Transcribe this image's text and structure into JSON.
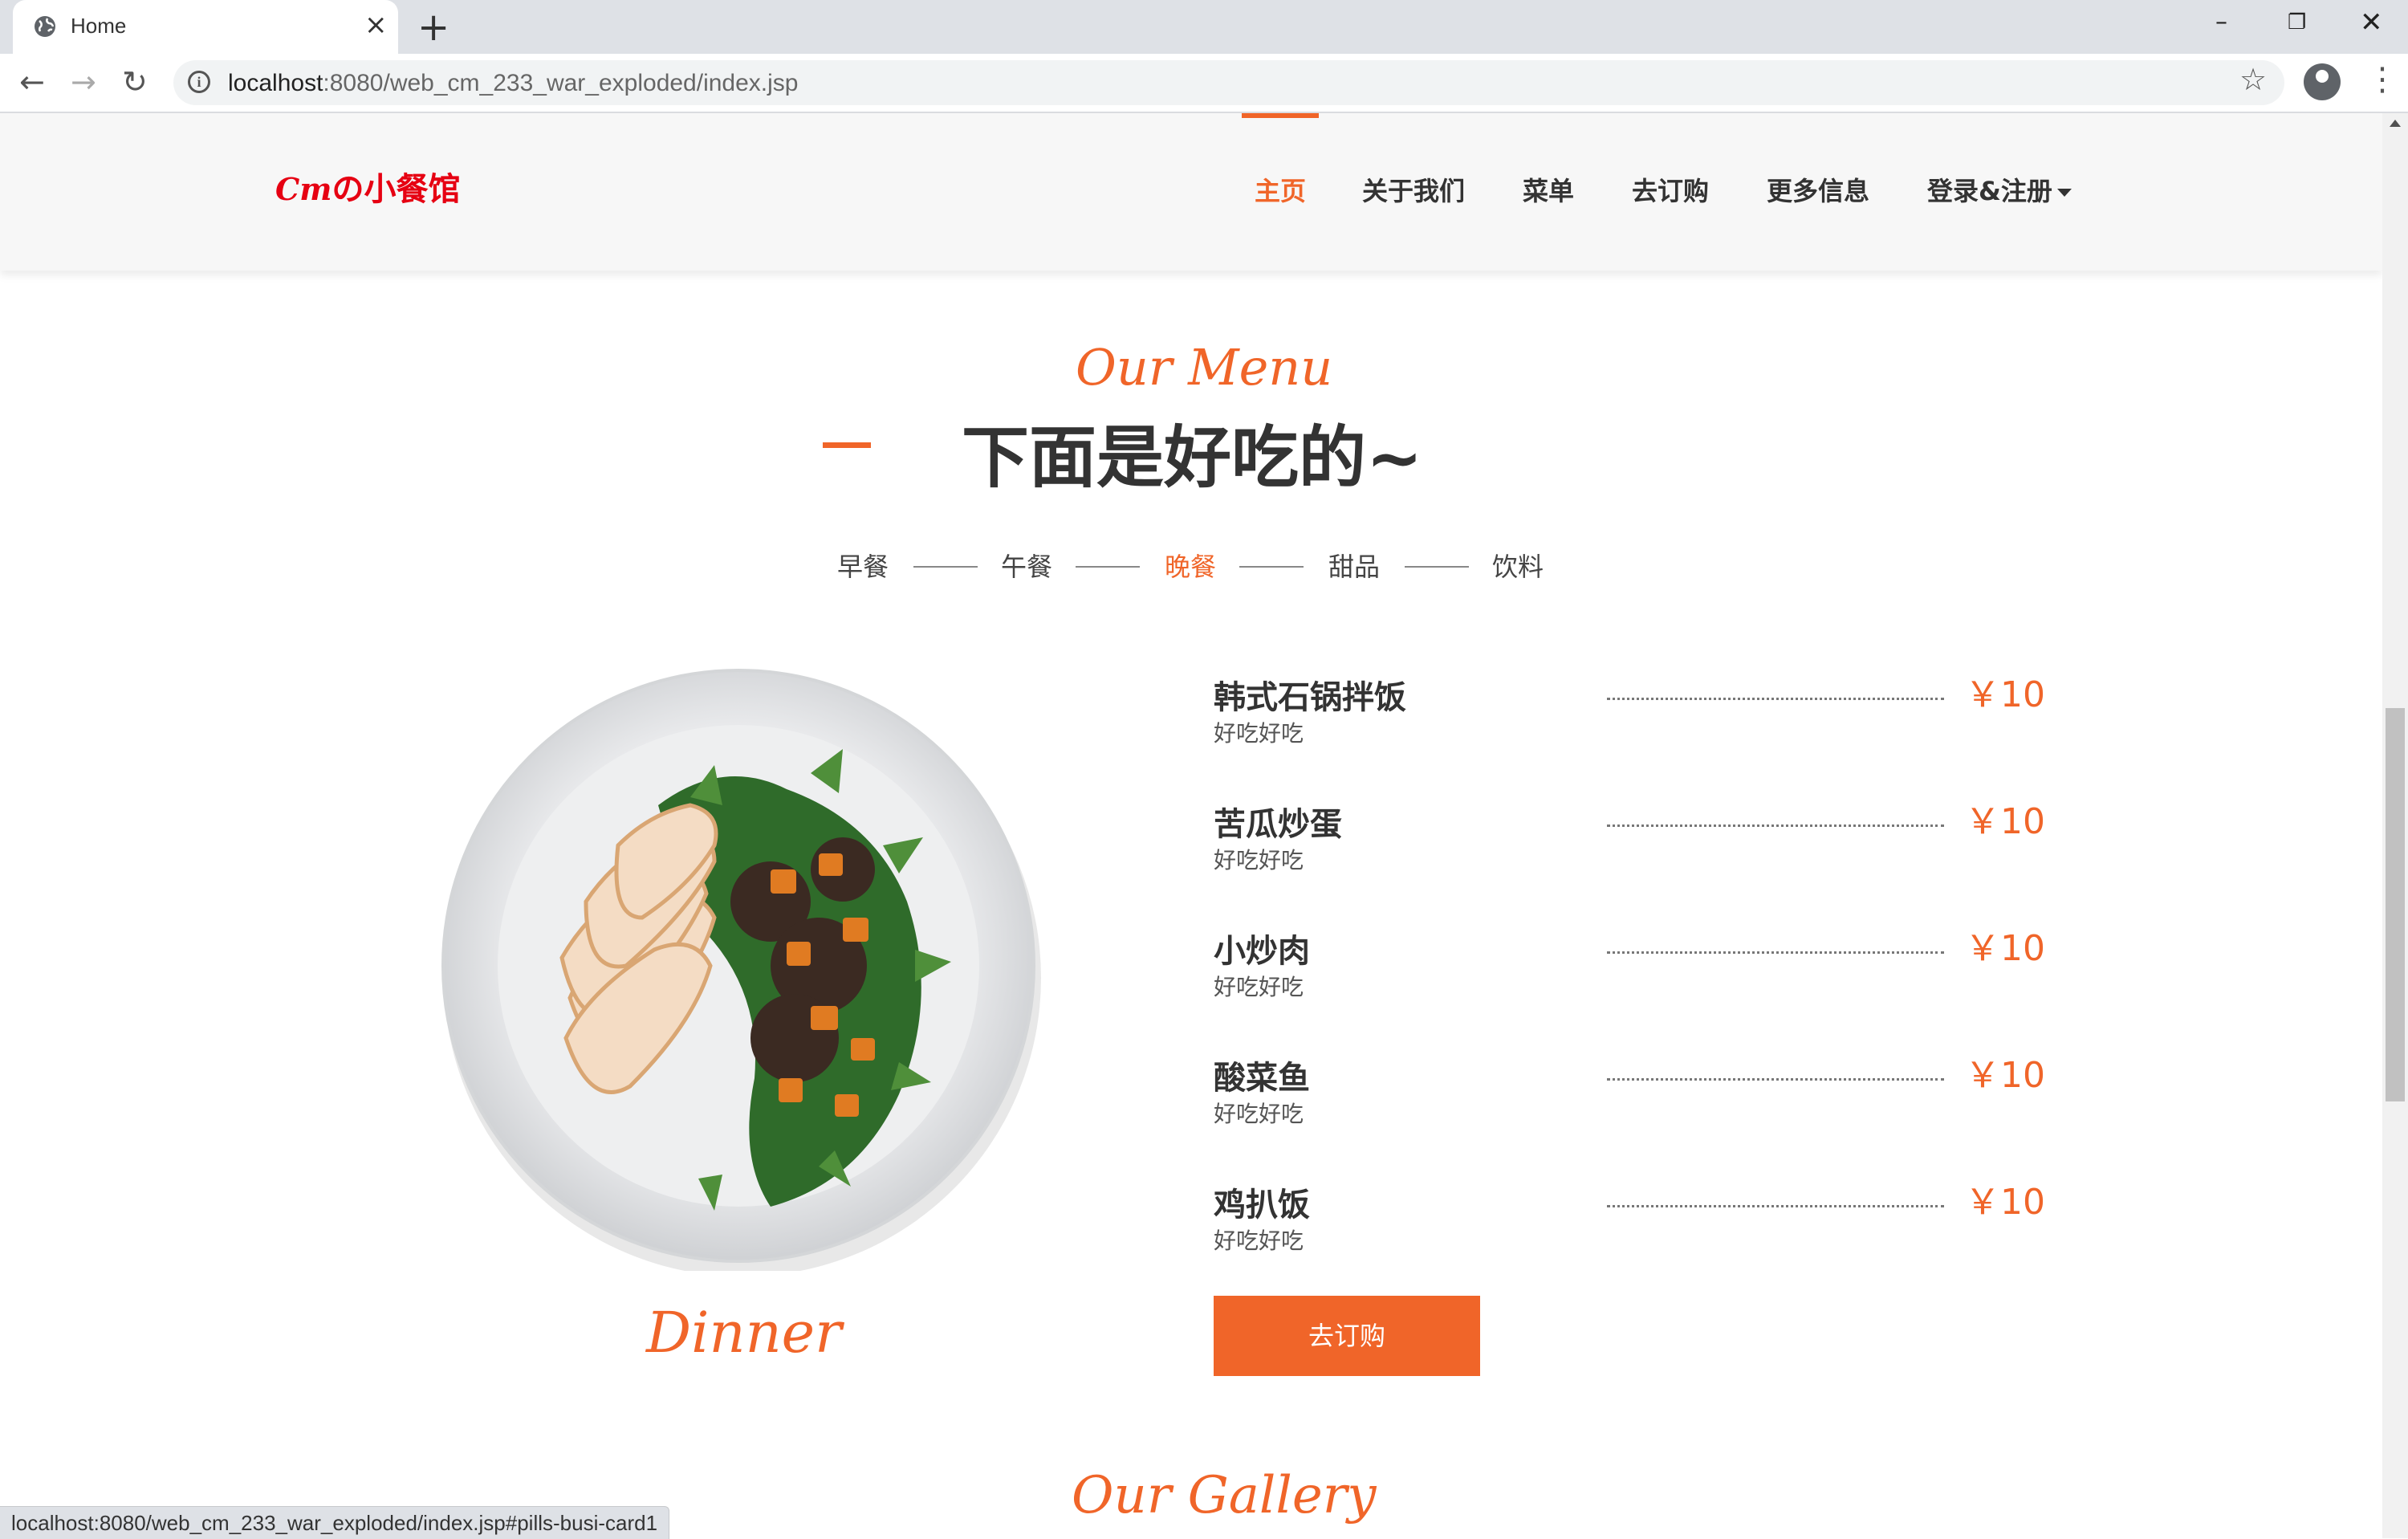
{
  "browser": {
    "tab_title": "Home",
    "url_host": "localhost",
    "url_rest": ":8080/web_cm_233_war_exploded/index.jsp",
    "status_url": "localhost:8080/web_cm_233_war_exploded/index.jsp#pills-busi-card1"
  },
  "site": {
    "logo_script": "Cm",
    "logo_text": "の小餐馆",
    "nav": [
      "主页",
      "关于我们",
      "菜单",
      "去订购",
      "更多信息",
      "登录&注册"
    ],
    "active_nav": "主页"
  },
  "menu_section": {
    "script_heading": "Our Menu",
    "title": "下面是好吃的~",
    "categories": [
      "早餐",
      "午餐",
      "晚餐",
      "甜品",
      "饮料"
    ],
    "active_category": "晚餐",
    "image_caption": "Dinner",
    "dishes": [
      {
        "name": "韩式石锅拌饭",
        "desc": "好吃好吃",
        "price": "￥10"
      },
      {
        "name": "苦瓜炒蛋",
        "desc": "好吃好吃",
        "price": "￥10"
      },
      {
        "name": "小炒肉",
        "desc": "好吃好吃",
        "price": "￥10"
      },
      {
        "name": "酸菜鱼",
        "desc": "好吃好吃",
        "price": "￥10"
      },
      {
        "name": "鸡扒饭",
        "desc": "好吃好吃",
        "price": "￥10"
      }
    ],
    "order_button": "去订购"
  },
  "gallery_section": {
    "script_heading": "Our Gallery"
  },
  "colors": {
    "accent": "#f06529",
    "logo_red": "#e60012"
  }
}
